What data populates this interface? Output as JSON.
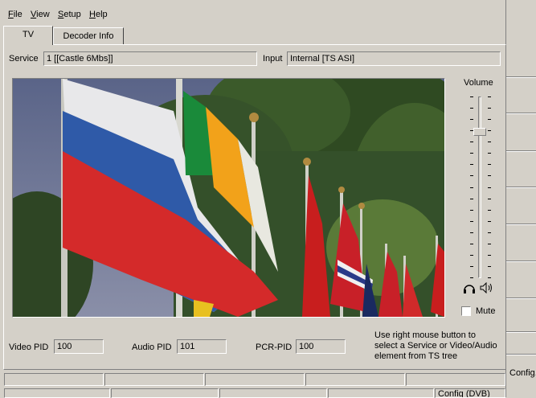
{
  "menu": [
    "File",
    "View",
    "Setup",
    "Help"
  ],
  "tabs": [
    "TV",
    "Decoder Info"
  ],
  "service": {
    "label": "Service",
    "value": "1 [[Castle 6Mbs]]"
  },
  "input": {
    "label": "Input",
    "value": "Internal [TS ASI]"
  },
  "volume": {
    "label": "Volume",
    "level": 0.82
  },
  "mute": {
    "label": "Mute",
    "checked": false
  },
  "pids": {
    "video_label": "Video PID",
    "video_value": "100",
    "audio_label": "Audio PID",
    "audio_value": "101",
    "pcr_label": "PCR-PID",
    "pcr_value": "100"
  },
  "hint": [
    "Use right mouse button to",
    "select a Service or Video/Audio",
    "element from TS tree"
  ],
  "side": {
    "config": "Config."
  },
  "status": {
    "config_dvb": "Config (DVB)"
  },
  "icons": {
    "headphones": "headphones-icon",
    "speaker": "speaker-icon"
  }
}
